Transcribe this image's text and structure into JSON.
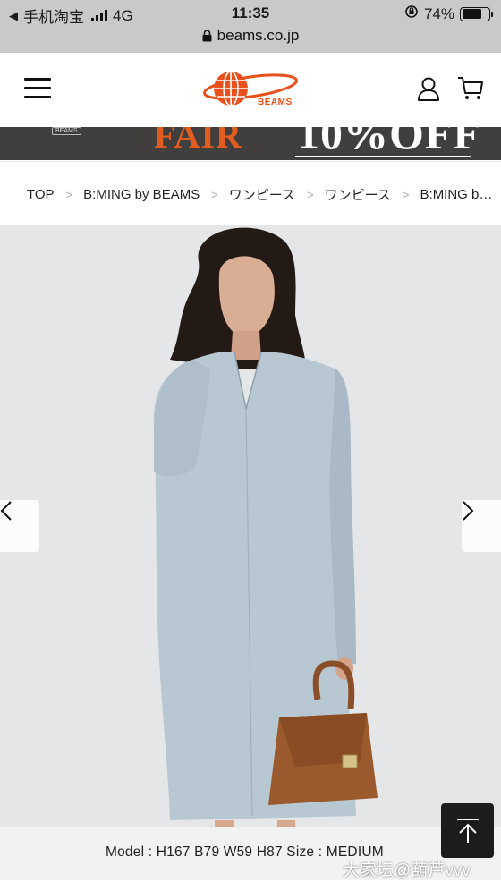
{
  "status_bar": {
    "back_app": "手机淘宝",
    "network": "4G",
    "time": "11:35",
    "battery_percent_label": "74%",
    "battery_level": 0.74
  },
  "browser": {
    "url": "beams.co.jp"
  },
  "header": {
    "logo_text": "BEAMS",
    "brand_color": "#e8501c"
  },
  "promo_banner": {
    "brand_mark": "BEAMS",
    "fair_text": "FAIR",
    "discount_text": "10%OFF",
    "fair_color": "#e25c1f"
  },
  "breadcrumb": {
    "items": [
      "TOP",
      "B:MING by BEAMS",
      "ワンピース",
      "ワンピース",
      "B:MING b…"
    ],
    "separator": ">"
  },
  "product": {
    "caption": "Model : H167 B79 W59 H87 Size : MEDIUM",
    "dress_color": "#b8c8d3",
    "bag_color": "#9b5a2e"
  },
  "watermark": "大家坛@葫芦vvv"
}
